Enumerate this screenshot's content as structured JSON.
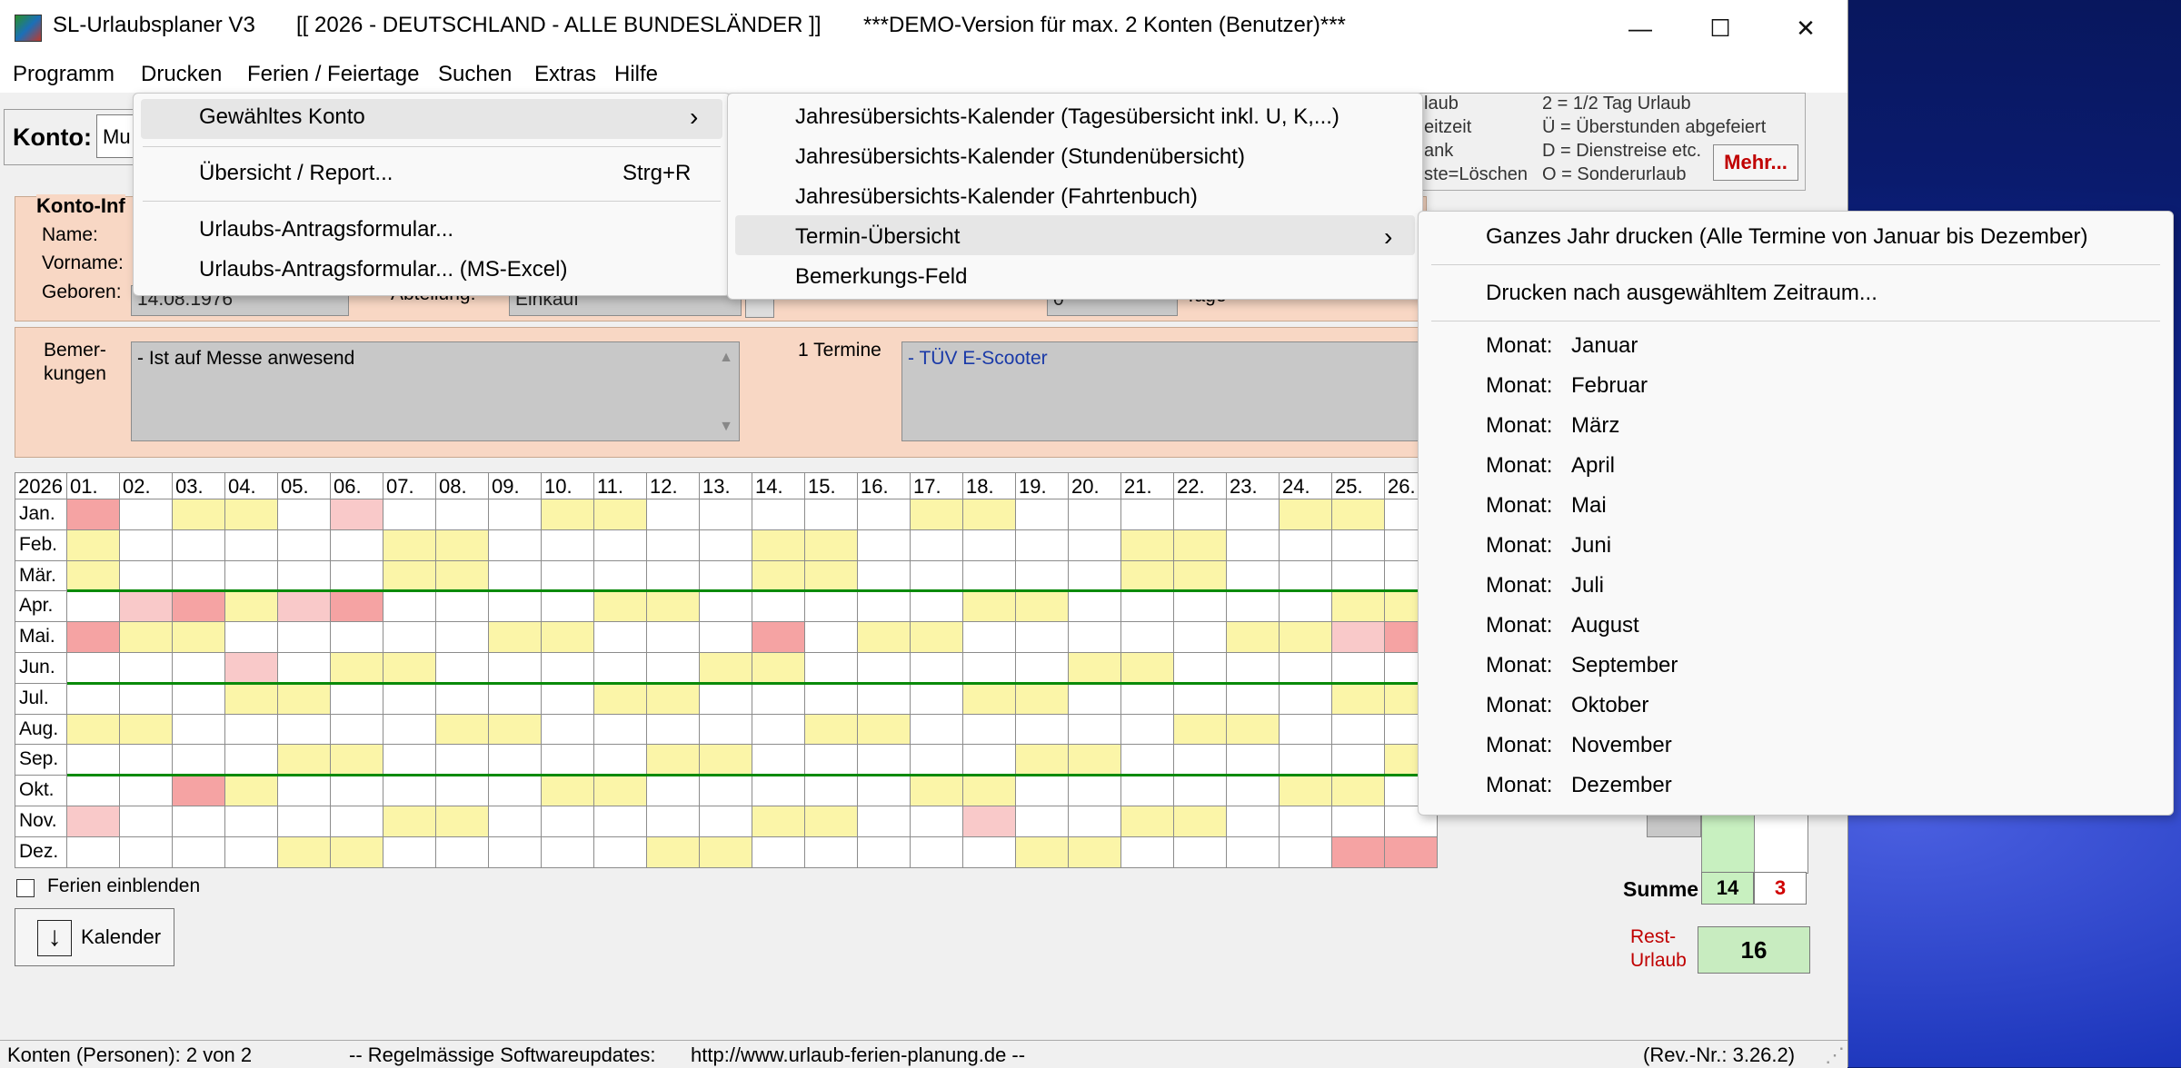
{
  "titlebar": {
    "app_name": "SL-Urlaubsplaner V3",
    "year_region": "[[ 2026 - DEUTSCHLAND - ALLE BUNDESLÄNDER ]]",
    "demo_notice": "***DEMO-Version für max. 2 Konten (Benutzer)***",
    "minimize": "—",
    "maximize": "☐",
    "close": "✕"
  },
  "menubar": [
    "Programm",
    "Drucken",
    "Ferien / Feiertage",
    "Suchen",
    "Extras",
    "Hilfe"
  ],
  "konto": {
    "label": "Konto:",
    "value": "Mu"
  },
  "info": {
    "title": "Konto-Inf",
    "name_label": "Name:",
    "vorname_label": "Vorname:",
    "geboren_label": "Geboren:",
    "geboren_value": "14.08.1976",
    "abteilung_label": "Abteilung:",
    "abteilung_value": "Einkauf",
    "tage_value": "0",
    "tage_label": "Tage"
  },
  "remarks": {
    "label_line1": "Bemer-",
    "label_line2": "kungen",
    "text": "- Ist auf Messe anwesend",
    "termine_label": "1 Termine",
    "termine_text": "- TÜV E-Scooter"
  },
  "legend": {
    "line1_left": "laub",
    "line1_right": "2 = 1/2 Tag Urlaub",
    "line2_left": "eitzeit",
    "line2_right": "Ü = Überstunden abgefeiert",
    "line3_left": "ank",
    "line3_right": "D = Dienstreise etc.",
    "line4_left": "ste=Löschen",
    "line4_right": "O = Sonderurlaub",
    "mehr_button": "Mehr..."
  },
  "calendar": {
    "year": "2026",
    "days": [
      "01.",
      "02.",
      "03.",
      "04.",
      "05.",
      "06.",
      "07.",
      "08.",
      "09.",
      "10.",
      "11.",
      "12.",
      "13.",
      "14.",
      "15.",
      "16.",
      "17.",
      "18.",
      "19.",
      "20.",
      "21.",
      "22.",
      "23.",
      "24.",
      "25.",
      "26."
    ],
    "months": [
      "Jan.",
      "Feb.",
      "Mär.",
      "Apr.",
      "Mai.",
      "Jun.",
      "Jul.",
      "Aug.",
      "Sep.",
      "Okt.",
      "Nov.",
      "Dez."
    ]
  },
  "ferien_label": "Ferien einblenden",
  "kalender_button": "Kalender",
  "summe": {
    "label": "Summe",
    "value1": "14",
    "value2": "3"
  },
  "rest": {
    "label_line1": "Rest-",
    "label_line2": "Urlaub",
    "value": "16"
  },
  "status": {
    "konten": "Konten (Personen): 2 von 2",
    "updates": "-- Regelmässige Softwareupdates:",
    "url": "http://www.urlaub-ferien-planung.de --",
    "rev": "(Rev.-Nr.: 3.26.2)"
  },
  "menu_drucken": [
    {
      "label": "Gewähltes Konto",
      "shortcut": "›"
    },
    {
      "label": "Übersicht / Report...",
      "shortcut": "Strg+R"
    },
    {
      "label": "Urlaubs-Antragsformular...",
      "shortcut": ""
    },
    {
      "label": "Urlaubs-Antragsformular... (MS-Excel)",
      "shortcut": ""
    }
  ],
  "submenu_konto": [
    {
      "label": "Jahresübersichts-Kalender (Tagesübersicht inkl. U, K,...)"
    },
    {
      "label": "Jahresübersichts-Kalender (Stundenübersicht)"
    },
    {
      "label": "Jahresübersichts-Kalender (Fahrtenbuch)"
    },
    {
      "label": "Termin-Übersicht",
      "arrow": "›"
    },
    {
      "label": "Bemerkungs-Feld"
    }
  ],
  "submenu_termin": {
    "top1": "Ganzes Jahr drucken (Alle Termine von Januar bis Dezember)",
    "top2": "Drucken nach ausgewähltem Zeitraum...",
    "month_prefix": "Monat:",
    "months": [
      "Januar",
      "Februar",
      "März",
      "April",
      "Mai",
      "Juni",
      "Juli",
      "August",
      "September",
      "Oktober",
      "November",
      "Dezember"
    ]
  },
  "colors": {
    "weekend": "#fbf5a8",
    "holiday": "#f5a3a3",
    "holiday_light": "#f9c9c9",
    "vacation_marker": "#2ecc2e",
    "panel": "#f8d7c4",
    "mehr_text": "#c00000",
    "rest_text": "#c00000"
  }
}
